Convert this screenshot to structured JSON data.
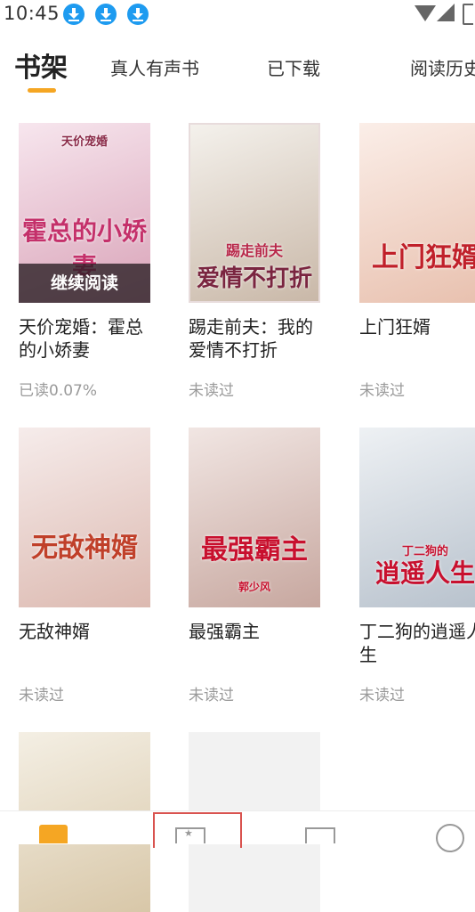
{
  "status_bar": {
    "time": "10:45",
    "download_count": 3,
    "icons": [
      "download-icon",
      "download-icon",
      "download-icon",
      "wifi-icon",
      "signal-icon",
      "battery-icon"
    ]
  },
  "tabs": [
    {
      "label": "书架",
      "active": true
    },
    {
      "label": "真人有声书",
      "active": false
    },
    {
      "label": "已下载",
      "active": false
    },
    {
      "label": "阅读历史",
      "active": false
    }
  ],
  "colors": {
    "accent": "#f5a623",
    "highlight_box": "#d9534f"
  },
  "books": [
    {
      "name": "天价宠婚：霍总的小娇妻",
      "status": "已读0.07%",
      "cover_text": "霍总的小娇妻",
      "cover_subtext": "天价宠婚",
      "overlay": "继续阅读",
      "palette": [
        "#f7e6ee",
        "#d9a3b8"
      ]
    },
    {
      "name": "踢走前夫：我的爱情不打折",
      "status": "未读过",
      "cover_text": "爱情不打折",
      "cover_subtext": "踢走前夫",
      "overlay": "",
      "palette": [
        "#f4f1ec",
        "#c9b8a8"
      ]
    },
    {
      "name": "上门狂婿",
      "status": "未读过",
      "cover_text": "上门狂婿",
      "cover_subtext": "",
      "overlay": "",
      "palette": [
        "#fbeee8",
        "#e8c0ae"
      ]
    },
    {
      "name": "无敌神婿",
      "status": "未读过",
      "cover_text": "无敌神婿",
      "cover_subtext": "",
      "overlay": "",
      "palette": [
        "#f6eceb",
        "#dcb9b0"
      ]
    },
    {
      "name": "最强霸主",
      "status": "未读过",
      "cover_text": "最强霸主",
      "cover_subtext": "郭少风",
      "overlay": "",
      "palette": [
        "#f1e6e3",
        "#c7a79f"
      ]
    },
    {
      "name": "丁二狗的逍遥人生",
      "status": "未读过",
      "cover_text": "逍遥人生",
      "cover_subtext": "丁二狗的",
      "overlay": "",
      "palette": [
        "#eef1f4",
        "#b7c1cc"
      ]
    },
    {
      "name": "",
      "status": "",
      "cover_text": "",
      "cover_subtext": "",
      "overlay": "",
      "palette": [
        "#f4efe4",
        "#d8c7a8"
      ]
    },
    {
      "name": "",
      "status": "",
      "cover_text": "",
      "cover_subtext": "",
      "overlay": "",
      "palette": [
        "#f2f2f2",
        "#f2f2f2"
      ]
    }
  ],
  "bottom_nav": [
    {
      "icon": "bookshelf-icon"
    },
    {
      "icon": "bookstore-icon"
    },
    {
      "icon": "page-icon"
    },
    {
      "icon": "profile-icon"
    }
  ]
}
